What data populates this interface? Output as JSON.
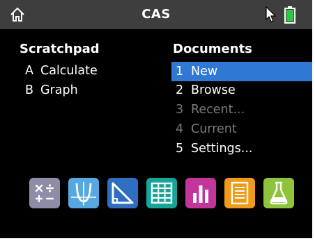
{
  "title": "CAS",
  "icons": {
    "home": "home-icon",
    "cursor": "pointer-cursor-icon",
    "battery": "battery-icon"
  },
  "scratchpad": {
    "heading": "Scratchpad",
    "items": [
      {
        "key": "A",
        "label": "Calculate"
      },
      {
        "key": "B",
        "label": "Graph"
      }
    ]
  },
  "documents": {
    "heading": "Documents",
    "items": [
      {
        "key": "1",
        "label": "New",
        "state": "selected"
      },
      {
        "key": "2",
        "label": "Browse",
        "state": "normal"
      },
      {
        "key": "3",
        "label": "Recent...",
        "state": "disabled"
      },
      {
        "key": "4",
        "label": "Current",
        "state": "disabled"
      },
      {
        "key": "5",
        "label": "Settings...",
        "state": "normal"
      }
    ]
  },
  "apps": [
    {
      "name": "calculator-app-icon",
      "color": "#8e8ca6"
    },
    {
      "name": "graphs-app-icon",
      "color": "#57a8e0"
    },
    {
      "name": "geometry-app-icon",
      "color": "#2f6fc0"
    },
    {
      "name": "lists-spreadsheet-app-icon",
      "color": "#17a59a"
    },
    {
      "name": "data-statistics-app-icon",
      "color": "#c2359b"
    },
    {
      "name": "notes-app-icon",
      "color": "#f19a1a"
    },
    {
      "name": "vernier-dataquest-app-icon",
      "color": "#8fc33b"
    }
  ],
  "colors": {
    "selection": "#2f78d4",
    "titlebar": "#3e3e3e",
    "disabled_text": "#7a7a7a"
  }
}
